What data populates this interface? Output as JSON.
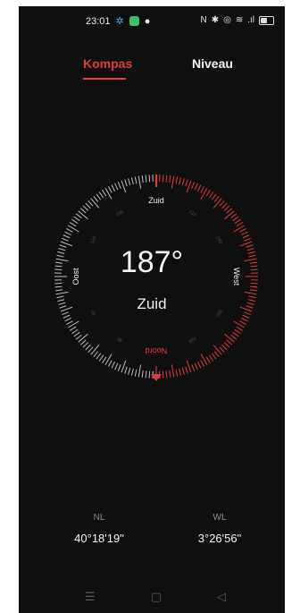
{
  "status_bar": {
    "time": "23:01",
    "icons": [
      "gear-icon",
      "app-icon",
      "location-pin-icon",
      "nfc-icon",
      "bluetooth-icon",
      "alarm-icon",
      "wifi-icon",
      "signal-icon",
      "battery-icon"
    ]
  },
  "tabs": [
    {
      "label": "Kompas",
      "active": true
    },
    {
      "label": "Niveau",
      "active": false
    }
  ],
  "compass": {
    "heading_degrees": 187,
    "heading_display": "187°",
    "direction": "Zuid",
    "cardinals": {
      "top": "Zuid",
      "right": "West",
      "bottom": "Noord",
      "left": "Oost"
    },
    "ring_numbers": [
      "210",
      "240",
      "300",
      "330",
      "30",
      "60",
      "120",
      "150"
    ],
    "accent_color": "#e23b3b",
    "tick_color": "#bdbdbd"
  },
  "coordinates": {
    "latitude_label": "NL",
    "latitude_value": "40°18'19\"",
    "longitude_label": "WL",
    "longitude_value": "3°26'56\""
  },
  "navbar": {
    "icons": [
      "menu-icon",
      "home-icon",
      "back-icon"
    ]
  }
}
